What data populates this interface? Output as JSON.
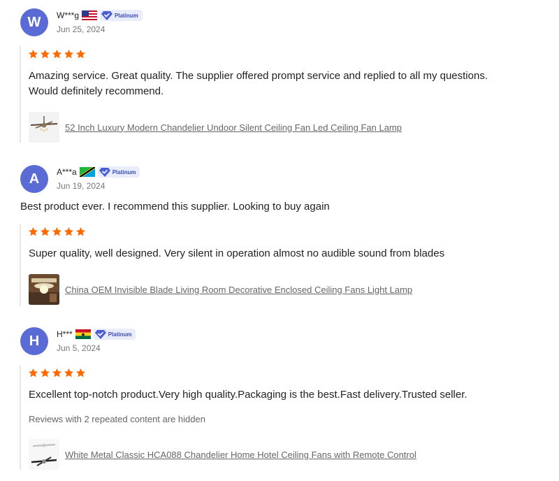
{
  "reviews": [
    {
      "avatar_letter": "W",
      "name": "W***g",
      "flag": "us-flag-icon",
      "badge": "Platinum",
      "date": "Jun 25, 2024",
      "buyer_comment": "",
      "rating": 5,
      "text_line1": "Amazing service. Great quality. The supplier offered prompt service and replied to all my questions.",
      "text_line2": "Would definitely recommend.",
      "hidden_note": "",
      "product_title": "52 Inch Luxury Modern Chandelier Undoor Silent Ceiling Fan Led Ceiling Fan Lamp",
      "product_icon": "ceiling-fan-thumbnail"
    },
    {
      "avatar_letter": "A",
      "name": "A***a",
      "flag": "tanzania-flag-icon",
      "badge": "Platinum",
      "date": "Jun 19, 2024",
      "buyer_comment": "Best product ever. I recommend this supplier. Looking to buy again",
      "rating": 5,
      "text_line1": "Super quality, well designed. Very silent in operation almost no audible sound from blades",
      "text_line2": "",
      "hidden_note": "",
      "product_title": "China OEM Invisible Blade Living Room Decorative Enclosed Ceiling Fans Light Lamp",
      "product_icon": "room-fan-thumbnail"
    },
    {
      "avatar_letter": "H",
      "name": "H***",
      "flag": "ghana-flag-icon",
      "badge": "Platinum",
      "date": "Jun 5, 2024",
      "buyer_comment": "",
      "rating": 5,
      "text_line1": "Excellent top-notch product.Very high quality.Packaging is the best.Fast delivery.Trusted seller.",
      "text_line2": "",
      "hidden_note": "Reviews with 2 repeated content are hidden",
      "product_title": "White Metal Classic HCA088 Chandelier Home Hotel Ceiling Fans with Remote Control",
      "product_icon": "white-fan-thumbnail"
    }
  ],
  "colors": {
    "avatar": "#5a6bd6",
    "star": "#ff6a00",
    "badge_bg": "#e9ecfb",
    "badge_text": "#3a4bb8"
  }
}
